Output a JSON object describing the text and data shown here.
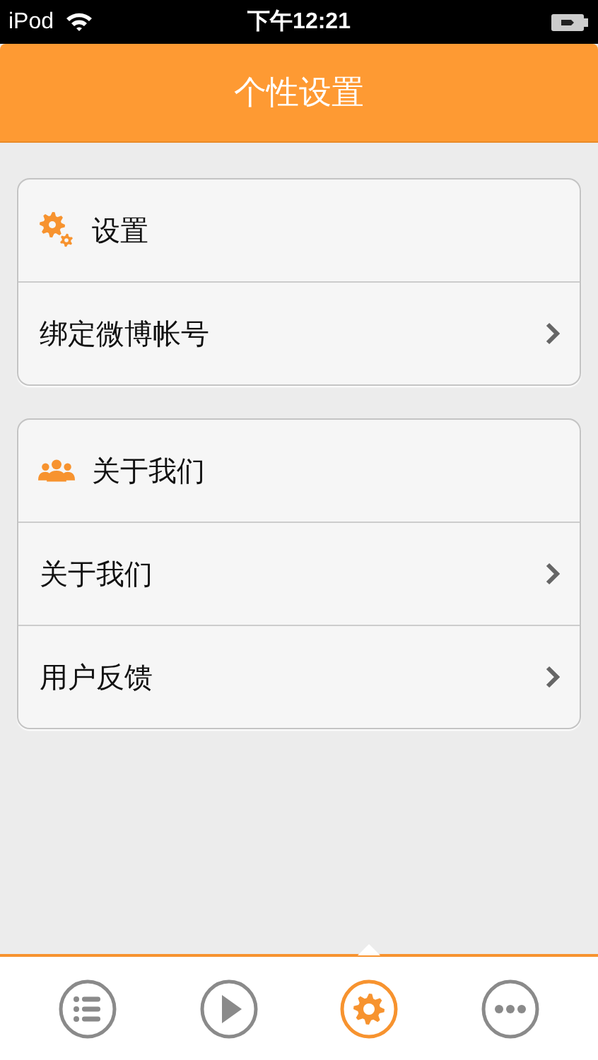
{
  "status_bar": {
    "carrier": "iPod",
    "time": "下午12:21"
  },
  "header": {
    "title": "个性设置"
  },
  "groups": [
    {
      "title": "设置",
      "kind": "gears",
      "items": [
        {
          "label": "绑定微博帐号"
        }
      ]
    },
    {
      "title": "关于我们",
      "kind": "people",
      "items": [
        {
          "label": "关于我们"
        },
        {
          "label": "用户反馈"
        }
      ]
    }
  ],
  "tabs": [
    {
      "kind": "list",
      "selected": false
    },
    {
      "kind": "play",
      "selected": false
    },
    {
      "kind": "gear",
      "selected": true
    },
    {
      "kind": "more",
      "selected": false
    }
  ]
}
